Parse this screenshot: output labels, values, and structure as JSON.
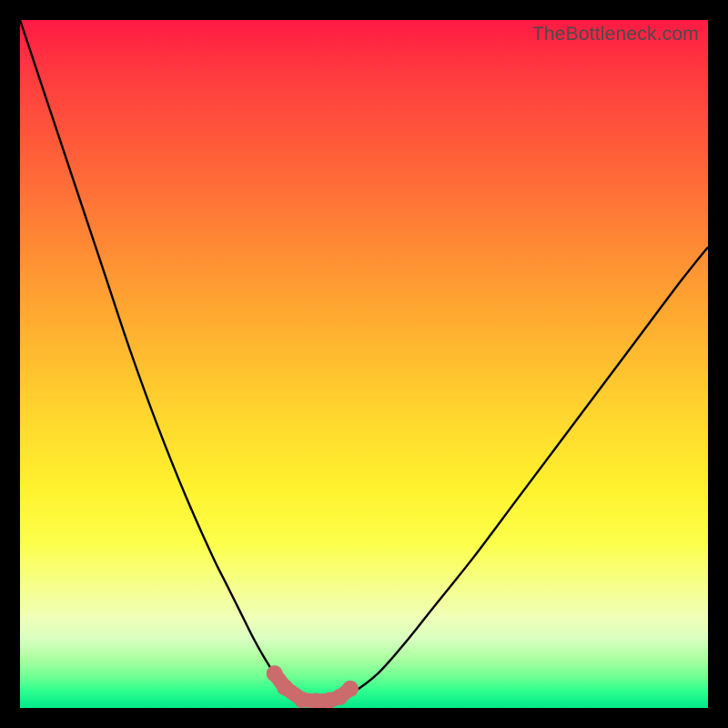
{
  "attribution": "TheBottleneck.com",
  "colors": {
    "black": "#000000",
    "curve_stroke": "#000000",
    "marker_fill": "#cc6b6b",
    "marker_stroke": "#cc6b6b",
    "gradient_top": "#ff1a44",
    "gradient_mid": "#fff22e",
    "gradient_bottom": "#00e88a"
  },
  "chart_data": {
    "type": "line",
    "title": "",
    "xlabel": "",
    "ylabel": "",
    "xlim": [
      0,
      100
    ],
    "ylim": [
      0,
      100
    ],
    "grid": false,
    "legend": false,
    "x": [
      0,
      4,
      8,
      12,
      16,
      20,
      24,
      28,
      30,
      32,
      34,
      36,
      38,
      40,
      42,
      44,
      46,
      48,
      52,
      56,
      60,
      66,
      72,
      78,
      84,
      90,
      96,
      100
    ],
    "values": [
      100,
      88,
      76,
      64,
      52,
      41,
      31,
      22,
      18,
      14,
      10,
      6.5,
      3.5,
      1.8,
      1.0,
      1.0,
      1.2,
      2.0,
      5.0,
      9.5,
      14.5,
      22,
      30,
      38,
      46,
      54,
      62,
      67
    ],
    "markers": {
      "x": [
        37,
        38.5,
        41,
        43,
        45,
        46.5,
        48
      ],
      "y": [
        5.0,
        3.0,
        1.2,
        1.0,
        1.1,
        1.6,
        2.8
      ]
    },
    "notes": "Axes unlabeled in source image; x/y normalized 0–100. Curve is a V-shaped bottleneck profile with minimum near x≈43. Pink markers cluster at the valley floor."
  }
}
